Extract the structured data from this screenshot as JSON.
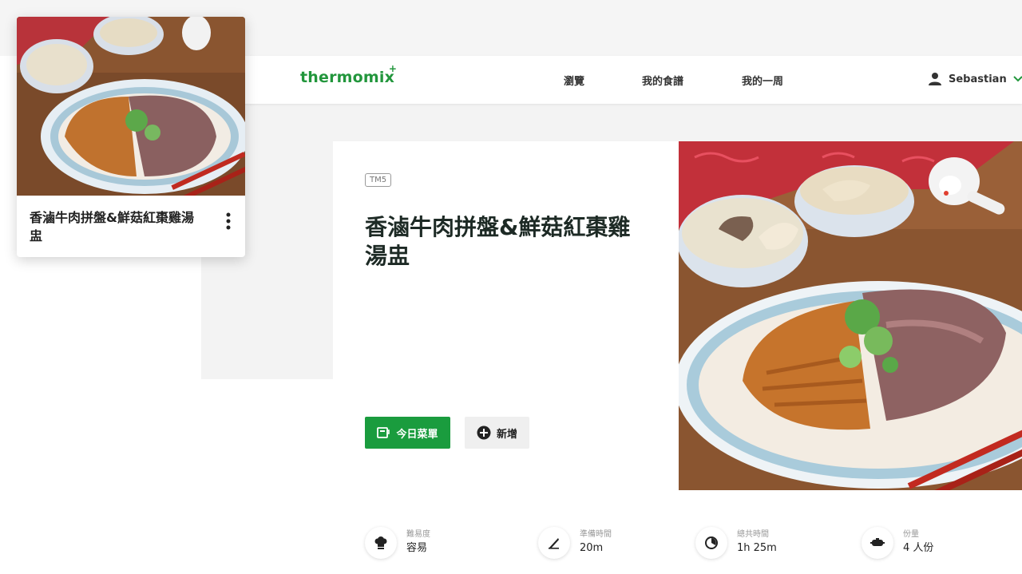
{
  "header": {
    "logo": "thermomix",
    "nav": [
      "瀏覽",
      "我的食譜",
      "我的一周"
    ],
    "user_name": "Sebastian"
  },
  "card": {
    "title": "香滷牛肉拼盤&鮮菇紅棗雞湯盅"
  },
  "recipe": {
    "badge": "TM5",
    "title": "香滷牛肉拼盤&鮮菇紅棗雞湯盅",
    "primary_button": "今日菜單",
    "secondary_button": "新增"
  },
  "info": [
    {
      "label": "難易度",
      "value": "容易",
      "icon": "chef-hat-icon"
    },
    {
      "label": "準備時間",
      "value": "20m",
      "icon": "knife-icon"
    },
    {
      "label": "總共時間",
      "value": "1h 25m",
      "icon": "timer-icon"
    },
    {
      "label": "份量",
      "value": "4 人份",
      "icon": "serving-dish-icon"
    }
  ],
  "colors": {
    "brand_green": "#22963c",
    "button_green": "#1a9c3e"
  }
}
